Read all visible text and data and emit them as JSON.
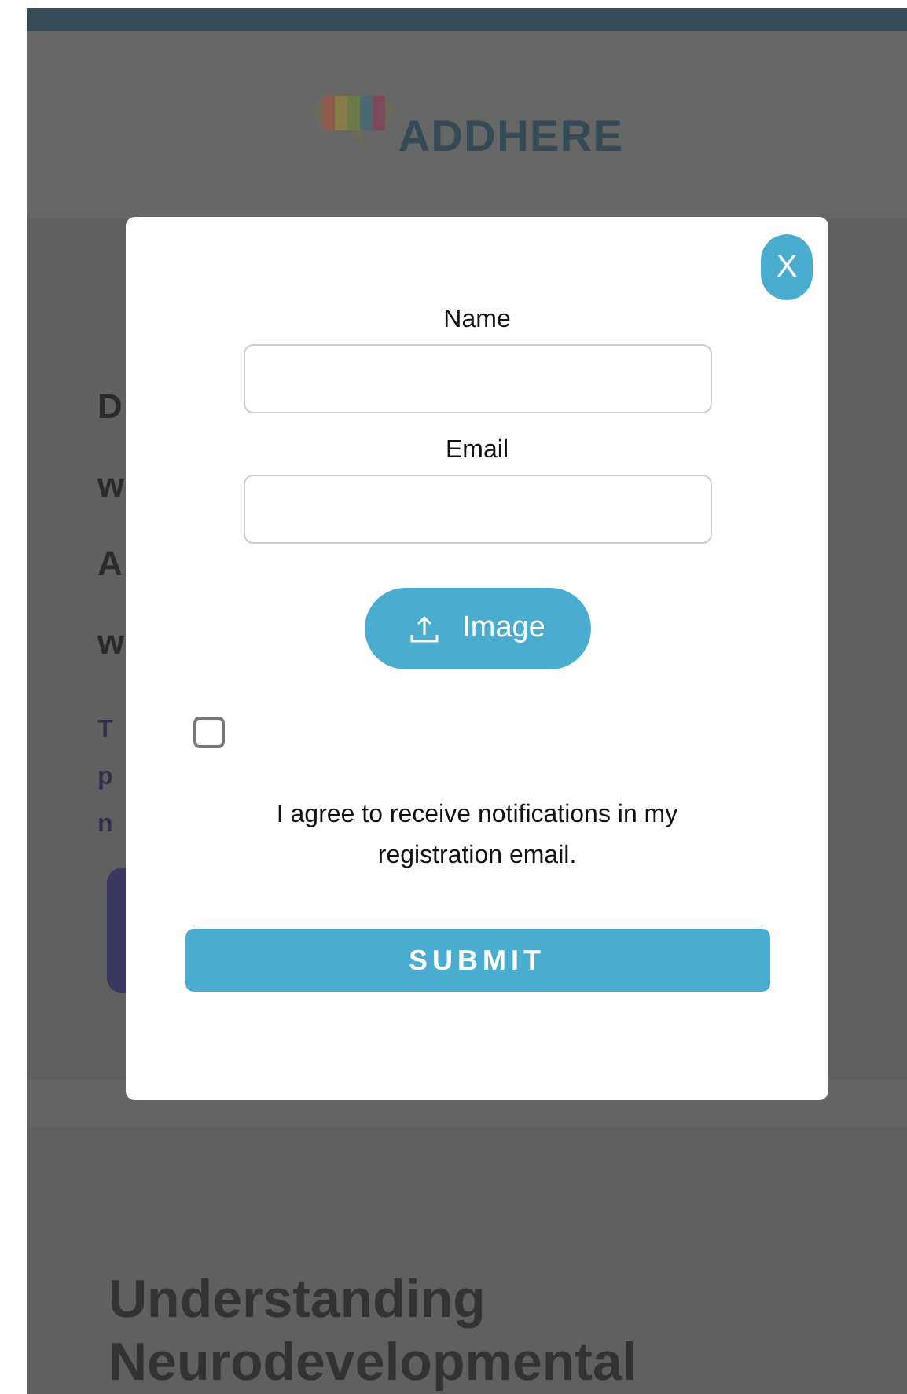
{
  "header": {
    "logo_text": "ADDHERE"
  },
  "background": {
    "heading_fragments": [
      "D",
      "w",
      "A",
      "w"
    ],
    "paragraph_fragments": [
      "T",
      "p",
      "n"
    ],
    "section_heading": [
      "Understanding",
      "Neurodevelopmental"
    ]
  },
  "modal": {
    "close_label": "X",
    "fields": [
      {
        "label": "Name"
      },
      {
        "label": "Email"
      }
    ],
    "upload_button": "Image",
    "consent": {
      "checked": false,
      "text": "I agree to receive notifications in my registration email."
    },
    "submit": "SUBMIT"
  }
}
